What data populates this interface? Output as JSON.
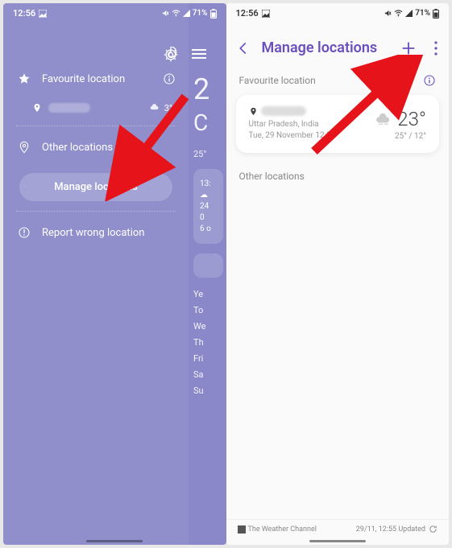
{
  "status": {
    "time": "12:56",
    "battery": "71%"
  },
  "left": {
    "favourite_label": "Favourite location",
    "other_label": "Other locations",
    "manage_label": "Manage locations",
    "report_label": "Report wrong location",
    "peek_temp": "2",
    "peek_feels": "C",
    "peek_hilo": "25°",
    "forecast_card": {
      "time": "13:",
      "temp": "24",
      "pct": "0",
      "note": "6 o"
    },
    "days": [
      "Ye",
      "To",
      "We",
      "Th",
      "Fri",
      "Sa",
      "Su"
    ]
  },
  "right": {
    "title": "Manage locations",
    "favourite_label": "Favourite location",
    "other_label": "Other locations",
    "city_sub1": "Uttar Pradesh, India",
    "city_sub2": "Tue, 29 November 12:56",
    "temp": "23°",
    "hilo": "25° / 12°",
    "footer_left": "The Weather Channel",
    "footer_right": "29/11, 12:55 Updated"
  }
}
